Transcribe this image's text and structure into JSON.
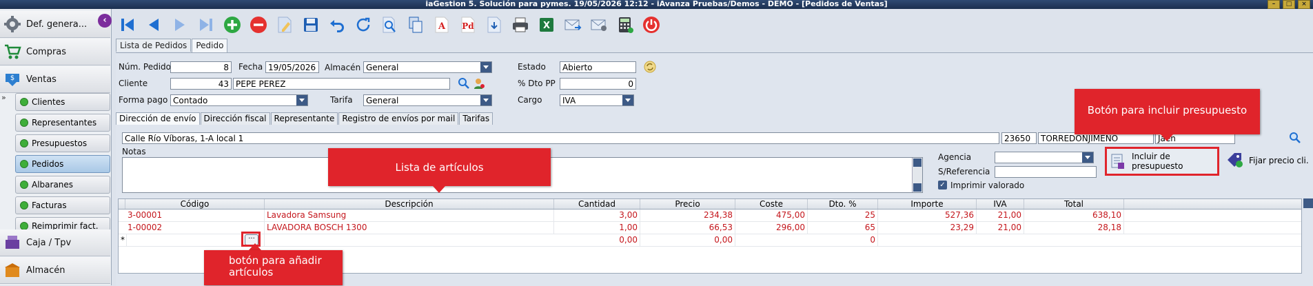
{
  "window": {
    "title": "iaGestion 5. Solución para pymes.   19/05/2026 12:12   -   iAvanza Pruebas/Demos - DEMO - [Pedidos de Ventas]"
  },
  "sidebar": {
    "main": [
      {
        "label": "Def. genera...",
        "icon": "gear-icon"
      },
      {
        "label": "Compras",
        "icon": "cart-icon"
      },
      {
        "label": "Ventas",
        "icon": "sales-icon"
      }
    ],
    "subitems": [
      {
        "label": "Clientes"
      },
      {
        "label": "Representantes"
      },
      {
        "label": "Presupuestos"
      },
      {
        "label": "Pedidos",
        "active": true
      },
      {
        "label": "Albaranes"
      },
      {
        "label": "Facturas"
      },
      {
        "label": "Reimprimir fact."
      }
    ],
    "bottom": [
      {
        "label": "Caja / Tpv",
        "icon": "cash-register-icon"
      },
      {
        "label": "Almacén",
        "icon": "warehouse-icon"
      }
    ]
  },
  "tabs": [
    "Lista de Pedidos",
    "Pedido"
  ],
  "form": {
    "num_pedido_label": "Núm. Pedido",
    "num_pedido": "8",
    "fecha_label": "Fecha",
    "fecha": "19/05/2026",
    "almacen_label": "Almacén",
    "almacen": "General",
    "estado_label": "Estado",
    "estado": "Abierto",
    "cliente_label": "Cliente",
    "cliente_codigo": "43",
    "cliente_nombre": "PEPE PEREZ",
    "dto_pp_label": "% Dto PP",
    "dto_pp": "0",
    "forma_pago_label": "Forma pago",
    "forma_pago": "Contado",
    "tarifa_label": "Tarifa",
    "tarifa": "General",
    "cargo_label": "Cargo",
    "cargo": "IVA"
  },
  "subtabs": [
    "Dirección de envío",
    "Dirección fiscal",
    "Representante",
    "Registro de envíos por mail",
    "Tarifas"
  ],
  "address": {
    "direccion": "Calle Río Víboras, 1-A local 1",
    "cp": "23650",
    "poblacion": "TORREDONJIMENO",
    "provincia": "Jaen"
  },
  "notas_label": "Notas",
  "agencia_label": "Agencia",
  "sreferencia_label": "S/Referencia",
  "imprimir_valorado_label": "Imprimir valorado",
  "incluir_presupuesto_label": "Incluir de presupuesto",
  "fijar_precio_label": "Fijar precio cli.",
  "grid": {
    "columns": [
      "Código",
      "Descripción",
      "Cantidad",
      "Precio",
      "Coste",
      "Dto. %",
      "Importe",
      "IVA",
      "Total"
    ],
    "rows": [
      [
        "3-00001",
        "Lavadora Samsung",
        "3,00",
        "234,38",
        "475,00",
        "25",
        "527,36",
        "21,00",
        "638,10"
      ],
      [
        "1-00002",
        "LAVADORA BOSCH 1300",
        "1,00",
        "66,53",
        "296,00",
        "65",
        "23,29",
        "21,00",
        "28,18"
      ]
    ],
    "new_row": {
      "marker": "*",
      "cantidad": "0,00",
      "precio": "0,00",
      "dto": "0"
    },
    "ellipsis": "···"
  },
  "callouts": {
    "lista": "Lista de artículos",
    "incluir": "Botón para incluir presupuesto",
    "anadir": "botón para añadir artículos"
  },
  "colors": {
    "accent": "#e0242b",
    "row_text": "#c4161c"
  }
}
